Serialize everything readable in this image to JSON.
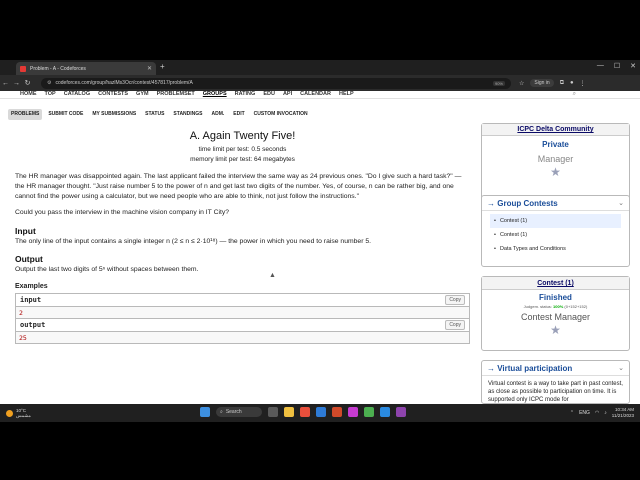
{
  "browser": {
    "tab_title": "Problem - A - Codeforces",
    "url": "codeforces.com/group/hazlMs3Ocr/contest/457817/problem/A",
    "zoom": "90%",
    "signin": "Sign in"
  },
  "topmenu": [
    "HOME",
    "TOP",
    "CATALOG",
    "CONTESTS",
    "GYM",
    "PROBLEMSET",
    "GROUPS",
    "RATING",
    "EDU",
    "API",
    "CALENDAR",
    "HELP"
  ],
  "secmenu": [
    "PROBLEMS",
    "SUBMIT CODE",
    "MY SUBMISSIONS",
    "STATUS",
    "STANDINGS",
    "ADM.",
    "EDIT",
    "CUSTOM INVOCATION"
  ],
  "problem": {
    "title": "A. Again Twenty Five!",
    "time_limit": "time limit per test: 0.5 seconds",
    "memory_limit": "memory limit per test: 64 megabytes",
    "legend1": "The HR manager was disappointed again. The last applicant failed the interview the same way as 24 previous ones. \"Do I give such a hard task?\" — the HR manager thought. \"Just raise number 5 to the power of n and get last two digits of the number. Yes, of course, n can be rather big, and one cannot find the power using a calculator, but we need people who are able to think, not just follow the instructions.\"",
    "legend2": "Could you pass the interview in the machine vision company in IT City?",
    "input_title": "Input",
    "input_text": "The only line of the input contains a single integer n (2 ≤ n ≤ 2·10¹⁸) — the power in which you need to raise number 5.",
    "output_title": "Output",
    "output_text": "Output the last two digits of 5ⁿ without spaces between them.",
    "examples_title": "Examples",
    "input_label": "input",
    "input_value": "2",
    "output_label": "output",
    "output_value": "25",
    "copy": "Copy"
  },
  "sidebar": {
    "group_title": "ICPC Delta Community",
    "group_status": "Private",
    "group_role": "Manager",
    "group_contests_title": "Group Contests",
    "group_contests": [
      "Contest (1)",
      "Contest (1)",
      "Data Types and Conditions"
    ],
    "contest_title": "Contest (1)",
    "contest_status": "Finished",
    "judgement_label": "Judgem. status:",
    "judgement_pct": "100%",
    "judgement_count": "(0+152+152)",
    "contest_role": "Contest Manager",
    "virtual_title": "Virtual participation",
    "virtual_text": "Virtual contest is a way to take part in past contest, as close as possible to participation on time. It is supported only ICPC mode for"
  },
  "taskbar": {
    "weather_temp": "10°C",
    "weather_desc": "مشمس",
    "search": "Search",
    "time": "10:34 AM",
    "date": "11/21/2023",
    "lang": "ENG"
  },
  "colors": {
    "accent": "#1a4d99",
    "screen_bg": "#ffffff",
    "chrome_bg": "#1f1f1f"
  }
}
